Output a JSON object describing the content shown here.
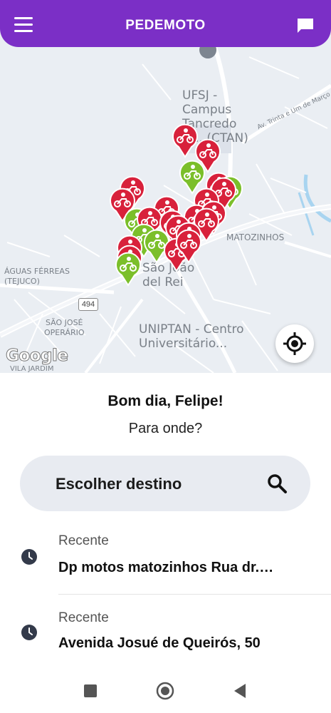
{
  "app": {
    "title": "PEDEMOTO",
    "menu_icon": "hamburger-menu-icon",
    "chat_icon": "chat-bubble-icon"
  },
  "map": {
    "labels": {
      "ufsj": "UFSJ - Campus Tancredo N... (CTAN)",
      "ufsj_line1": "UFSJ -",
      "ufsj_line2": "Campus",
      "ufsj_line3": "Tancredo",
      "ufsj_line4": "N... (CTAN)",
      "matozinhos": "MATOZINHOS",
      "aguas_line1": "ÁGUAS FÉRREAS",
      "aguas_line2": "(TEJUCO)",
      "sjose_line1": "SÃO JOSÉ",
      "sjose_line2": "OPERÁRIO",
      "saojoao_line1": "São João",
      "saojoao_line2": "del Rei",
      "uniptan_line1": "UNIPTAN - Centro",
      "uniptan_line2": "Universitário...",
      "vila": "VILA JARDIM",
      "trinta": "Av. Trinta e Um de Março",
      "road_shield": "494"
    },
    "attribution": "Google",
    "colors": {
      "red_pin": "#d8213b",
      "green_pin": "#7bbf2a",
      "brand": "#7b2fc6"
    },
    "pin_count_red": 20,
    "pin_count_green": 5
  },
  "greeting": "Bom dia, Felipe!",
  "question": "Para onde?",
  "search": {
    "label": "Escolher destino",
    "icon": "search-icon"
  },
  "recents": [
    {
      "kind": "Recente",
      "address": "Dp motos matozinhos Rua dr.…"
    },
    {
      "kind": "Recente",
      "address": "Avenida Josué de Queirós, 50"
    }
  ],
  "system_nav": [
    "square-recent-apps-icon",
    "circle-home-icon",
    "triangle-back-icon"
  ]
}
